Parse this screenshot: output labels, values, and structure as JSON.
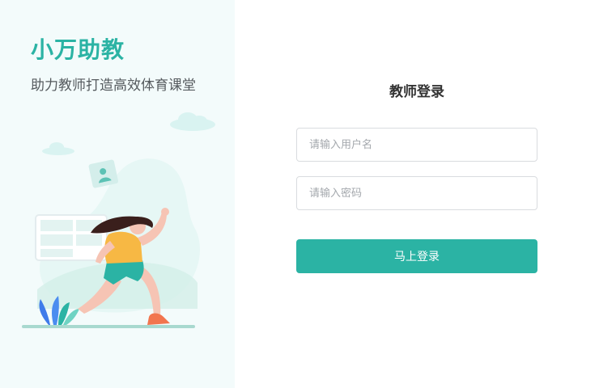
{
  "brand": {
    "title": "小万助教",
    "subtitle": "助力教师打造高效体育课堂",
    "accent_color": "#2bb3a4"
  },
  "illustration": {
    "description_icon": "runner-illustration",
    "elements": [
      "cloud-icon",
      "profile-card-icon",
      "schedule-board-icon",
      "plant-icon",
      "runner-figure"
    ]
  },
  "login": {
    "title": "教师登录",
    "username": {
      "placeholder": "请输入用户名",
      "value": ""
    },
    "password": {
      "placeholder": "请输入密码",
      "value": ""
    },
    "submit_label": "马上登录",
    "button_color": "#2bb3a4"
  }
}
